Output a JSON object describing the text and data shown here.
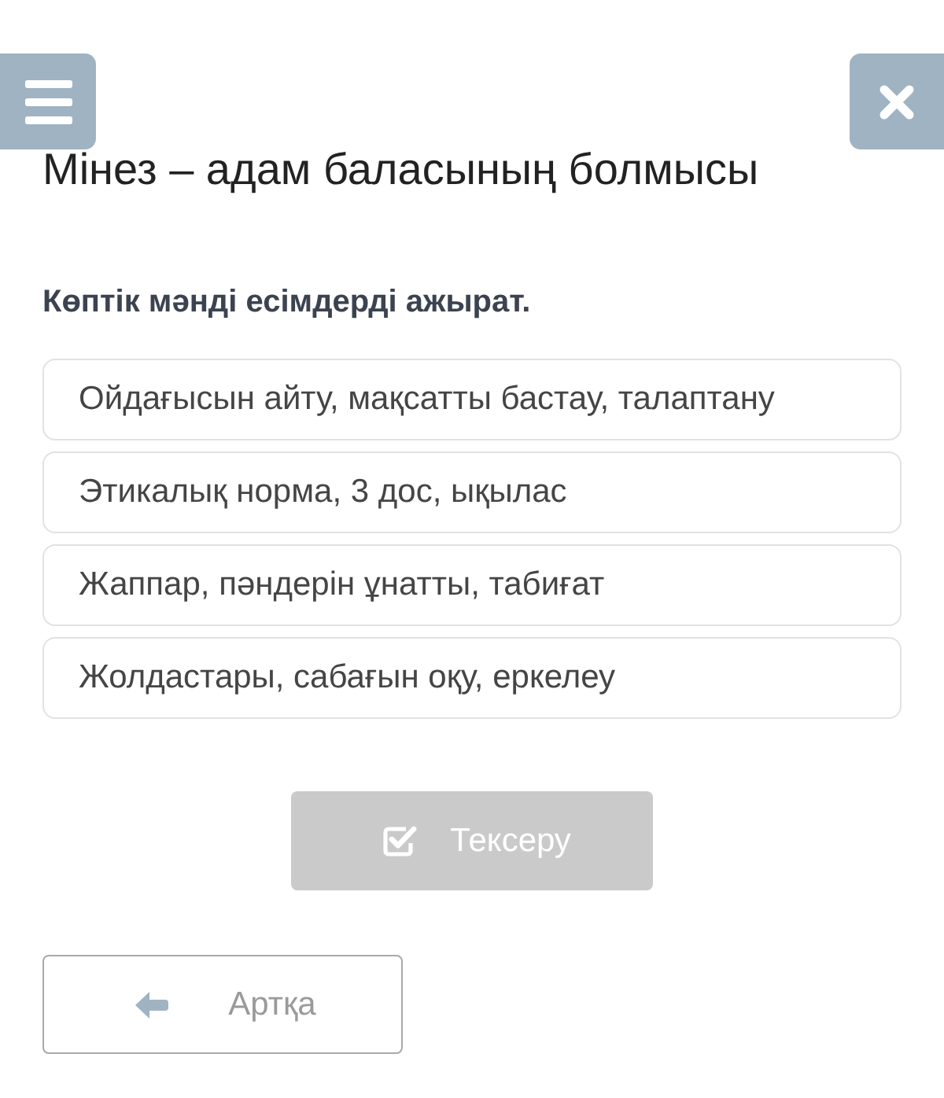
{
  "title": "Мінез – адам баласының болмысы",
  "question": "Көптік мәнді есімдерді ажырат.",
  "options": [
    {
      "text": "Ойдағысын айту, мақсатты бастау, талаптану",
      "selected": false
    },
    {
      "text": "Этикалық норма, 3 дос, ықылас",
      "selected": false
    },
    {
      "text": "Жаппар, пәндерін ұнатты, табиғат",
      "selected": false
    },
    {
      "text": "Жолдастары, сабағын оқу, еркелеу",
      "selected": false
    }
  ],
  "check_button": {
    "label": "Тексеру",
    "disabled": true
  },
  "back_button": {
    "label": "Артқа"
  }
}
